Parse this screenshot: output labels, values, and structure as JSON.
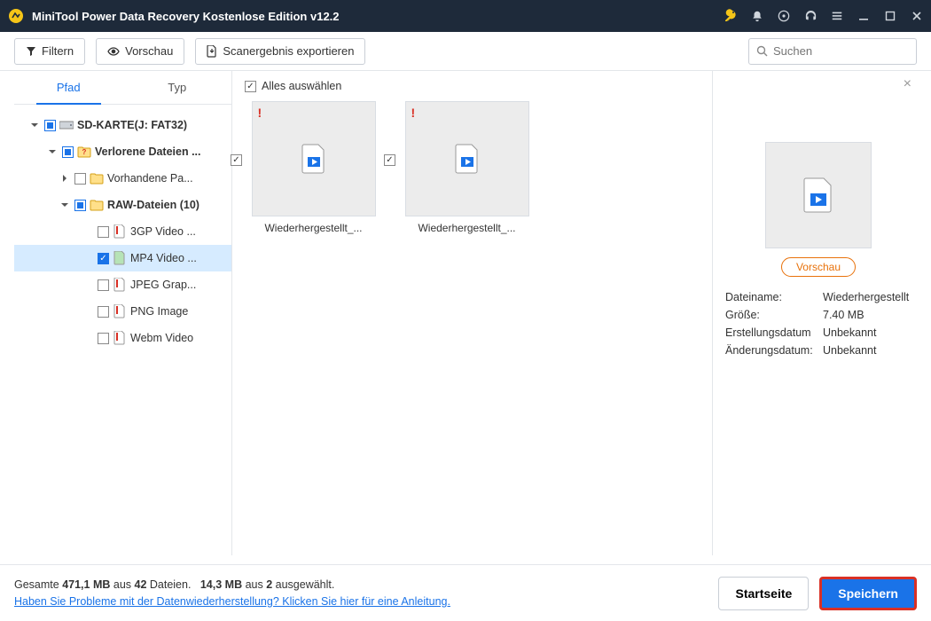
{
  "titlebar": {
    "title": "MiniTool Power Data Recovery Kostenlose Edition v12.2"
  },
  "toolbar": {
    "filter_label": "Filtern",
    "preview_label": "Vorschau",
    "export_label": "Scanergebnis exportieren",
    "search_placeholder": "Suchen"
  },
  "tabs": {
    "path": "Pfad",
    "type": "Typ",
    "active": "path"
  },
  "tree": {
    "root": {
      "label": "SD-KARTE(J: FAT32)",
      "state": "partial"
    },
    "lost": {
      "label": "Verlorene Dateien ...",
      "state": "partial"
    },
    "existing": {
      "label": "Vorhandene Pa...",
      "state": "unchecked"
    },
    "raw": {
      "label": "RAW-Dateien (10)",
      "state": "partial"
    },
    "leaves": [
      {
        "label": "3GP Video ...",
        "state": "unchecked",
        "access": "deleted"
      },
      {
        "label": "MP4 Video ...",
        "state": "checked",
        "access": "normal",
        "selected": true
      },
      {
        "label": "JPEG Grap...",
        "state": "unchecked",
        "access": "deleted"
      },
      {
        "label": "PNG Image",
        "state": "unchecked",
        "access": "deleted"
      },
      {
        "label": "Webm Video",
        "state": "unchecked",
        "access": "deleted"
      }
    ]
  },
  "grid": {
    "select_all_label": "Alles auswählen",
    "select_all_checked": true,
    "items": [
      {
        "name": "Wiederhergestellt_...",
        "checked": true,
        "warn": true
      },
      {
        "name": "Wiederhergestellt_...",
        "checked": true,
        "warn": true
      }
    ]
  },
  "preview": {
    "button_label": "Vorschau",
    "meta": [
      {
        "k": "Dateiname:",
        "v": "Wiederhergestellt"
      },
      {
        "k": "Größe:",
        "v": "7.40 MB"
      },
      {
        "k": "Erstellungsdatum",
        "v": "Unbekannt"
      },
      {
        "k": "Änderungsdatum:",
        "v": "Unbekannt"
      }
    ]
  },
  "footer": {
    "total_prefix": "Gesamte ",
    "total_size": "471,1 MB",
    "total_mid": " aus ",
    "total_files": "42",
    "total_suffix": " Dateien.",
    "sel_size": "14,3 MB",
    "sel_mid": " aus ",
    "sel_count": "2",
    "sel_suffix": " ausgewählt.",
    "help_link": "Haben Sie Probleme mit der Datenwiederherstellung? Klicken Sie hier für eine Anleitung.",
    "home_label": "Startseite",
    "save_label": "Speichern"
  }
}
